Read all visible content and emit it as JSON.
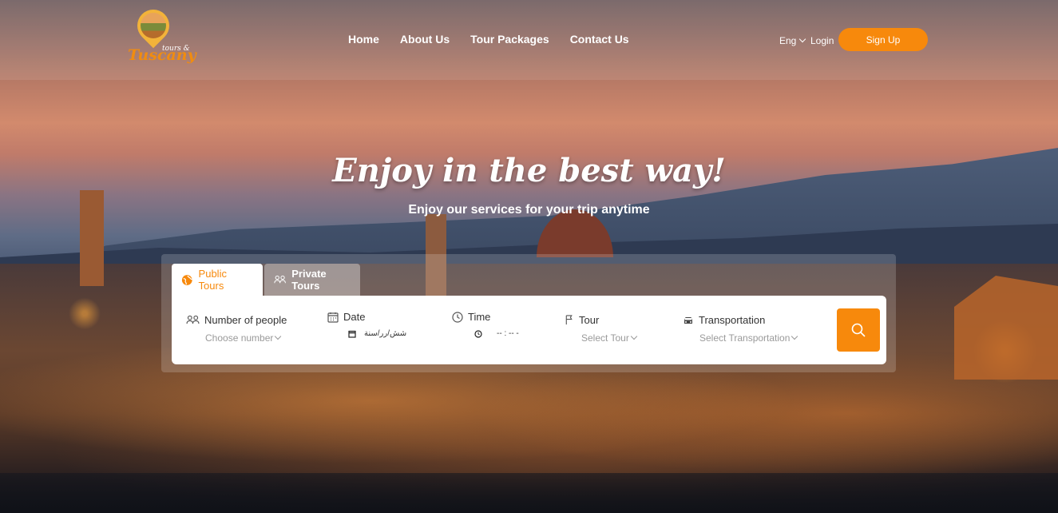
{
  "logo": {
    "brand": "Tuscany",
    "tagline": "tours &"
  },
  "nav": {
    "items": [
      "Home",
      "About Us",
      "Tour Packages",
      "Contact Us"
    ]
  },
  "header": {
    "language": "Eng",
    "login": "Login",
    "signup": "Sign Up"
  },
  "hero": {
    "headline": "Enjoy in the best way!",
    "subheadline": "Enjoy our services for your trip anytime"
  },
  "search": {
    "tabs": [
      {
        "label": "Public Tours",
        "active": true
      },
      {
        "label": "Private Tours",
        "active": false
      }
    ],
    "fields": {
      "people": {
        "label": "Number of people",
        "value": "Choose number"
      },
      "date": {
        "label": "Date",
        "value": "شش/رر/سنة"
      },
      "time": {
        "label": "Time",
        "value": "-- : --  -"
      },
      "tour": {
        "label": "Tour",
        "value": "Select Tour"
      },
      "transport": {
        "label": "Transportation",
        "value": "Select Transportation"
      }
    }
  },
  "colors": {
    "accent": "#f7890c",
    "text": "#333333",
    "placeholder": "#9a9a9a"
  }
}
